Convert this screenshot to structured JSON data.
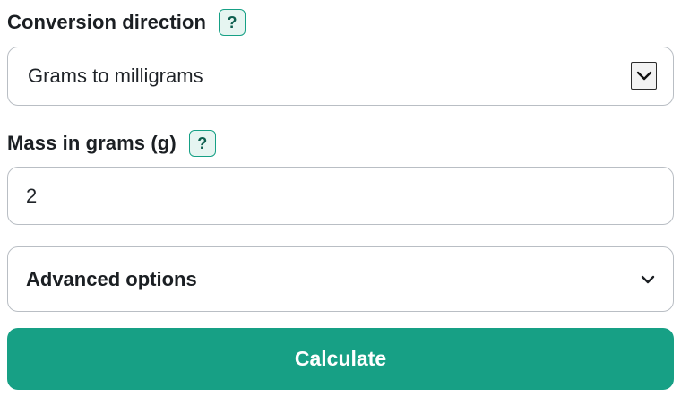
{
  "conversion": {
    "label": "Conversion direction",
    "help": "?",
    "selected": "Grams to milligrams"
  },
  "mass": {
    "label": "Mass in grams (g)",
    "help": "?",
    "value": "2"
  },
  "advanced": {
    "label": "Advanced options"
  },
  "actions": {
    "calculate_label": "Calculate"
  },
  "colors": {
    "accent": "#17a085",
    "help_bg": "#e6f5f1",
    "border": "#b9bec4"
  },
  "icons": {
    "select_arrow": "chevron-down-icon",
    "advanced_toggle": "chevron-down-icon",
    "help": "question-mark-icon"
  }
}
